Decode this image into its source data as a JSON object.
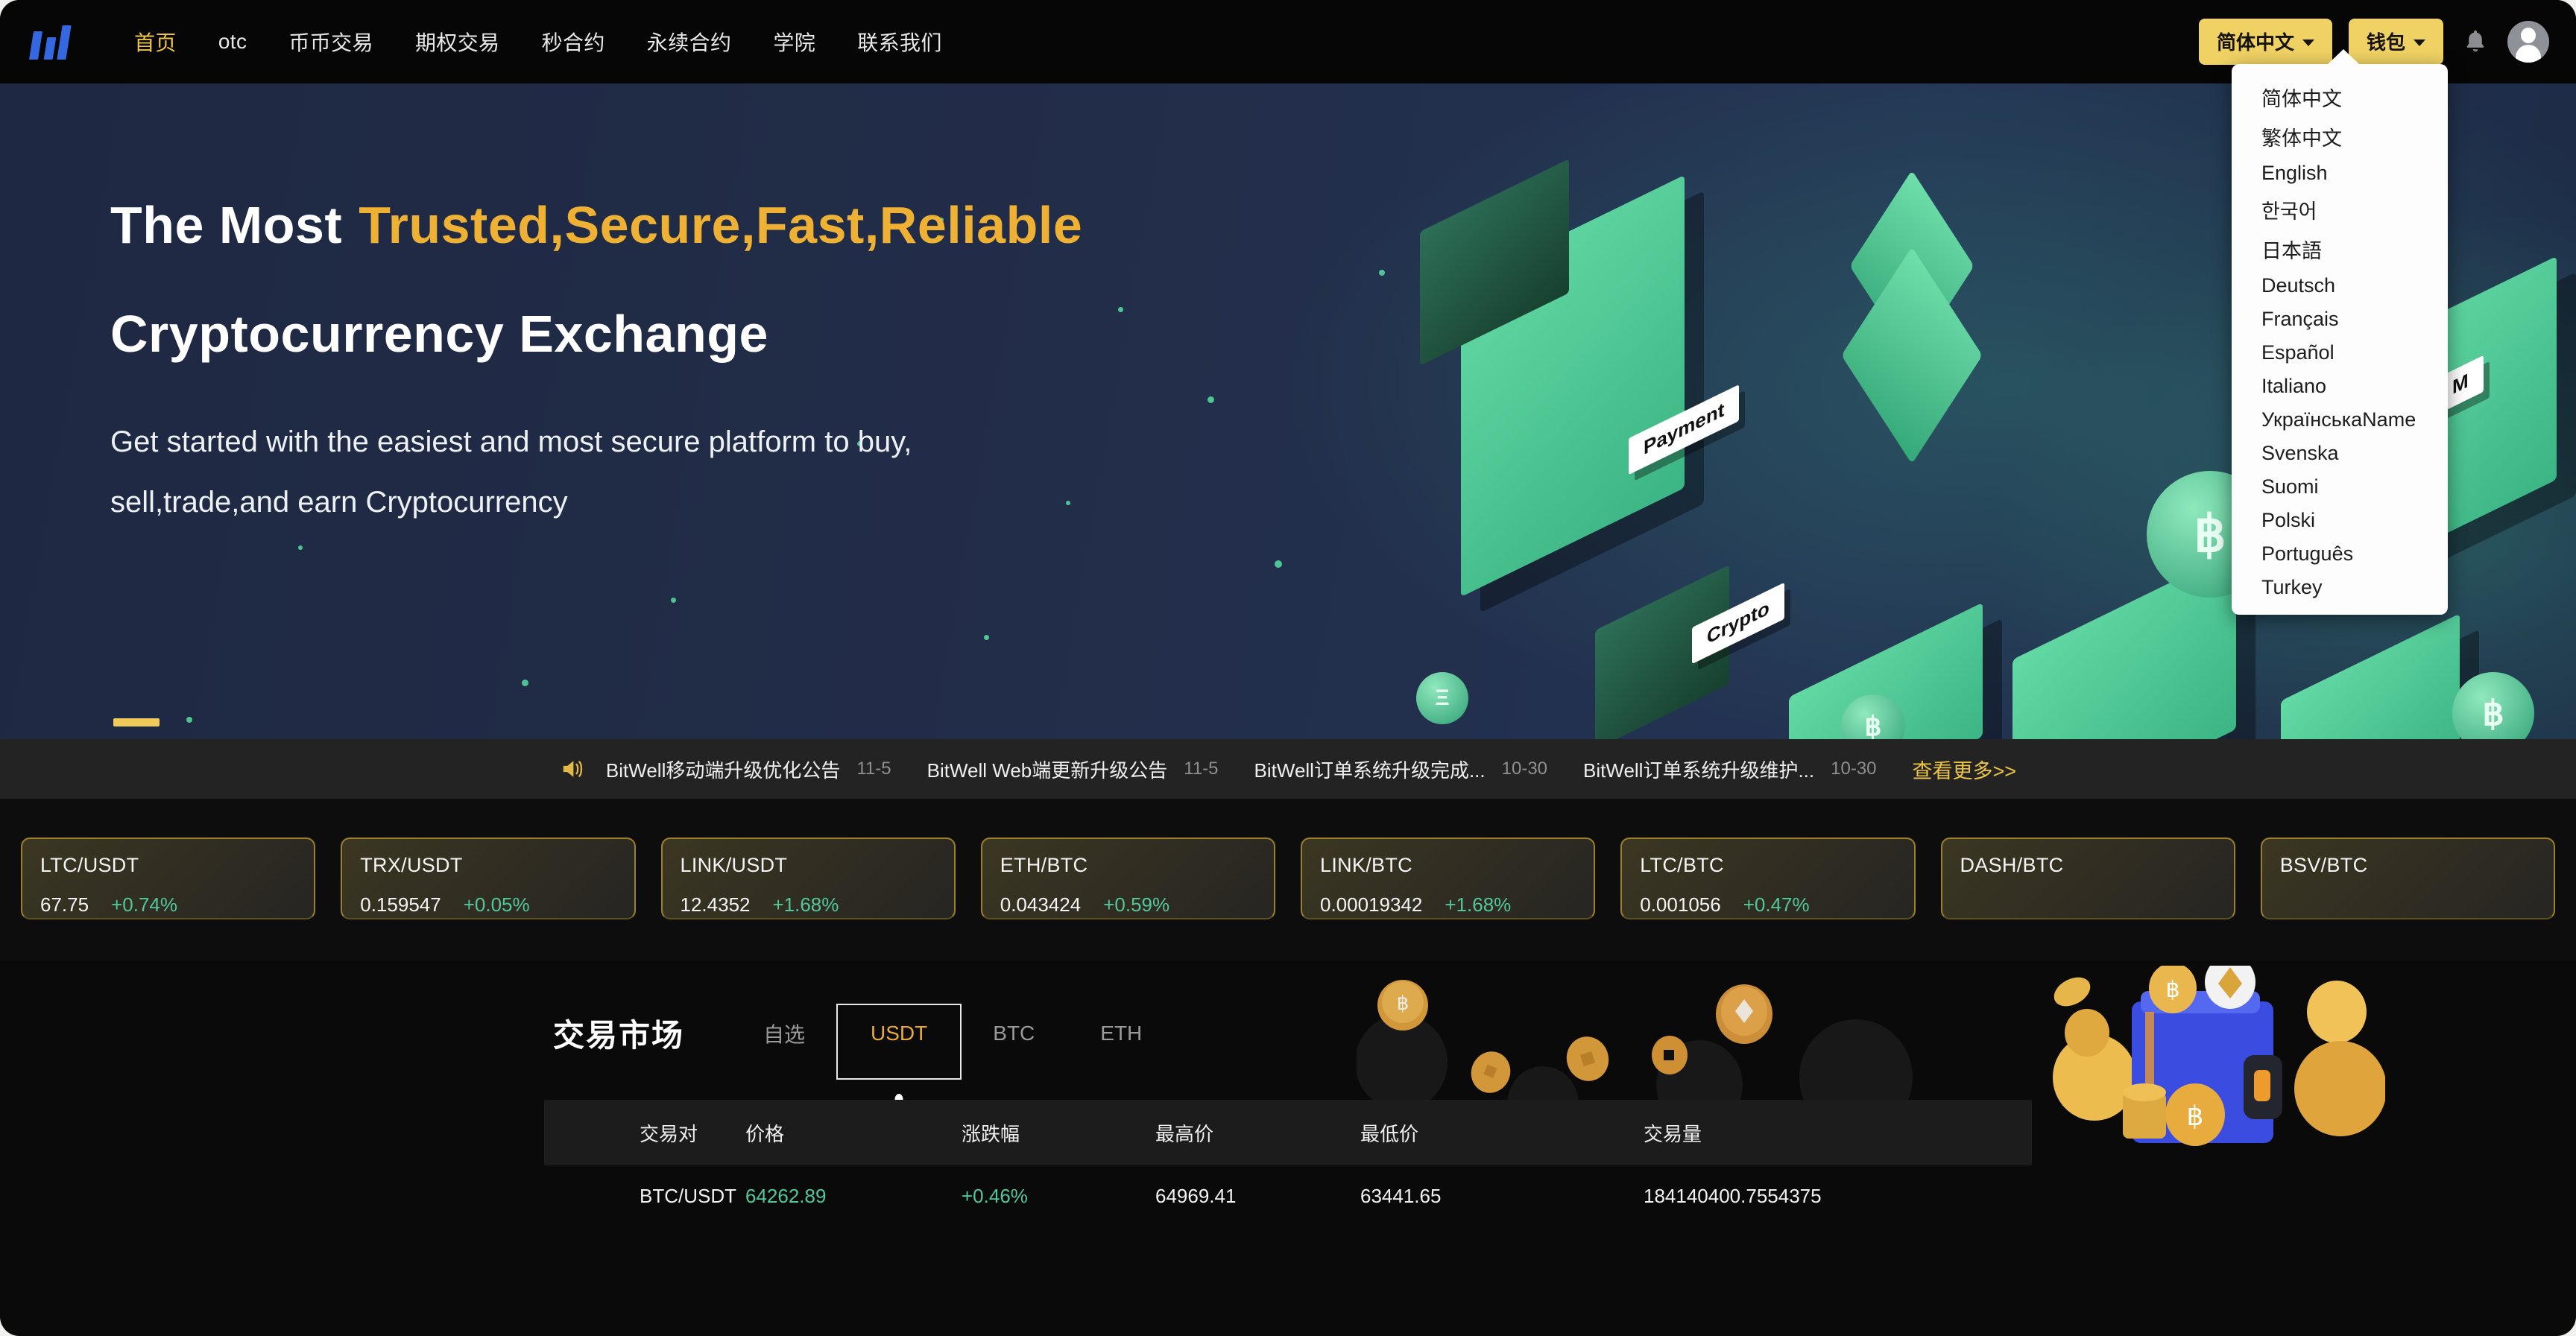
{
  "nav": {
    "logo_name": "bitwell-logo",
    "links": [
      {
        "label": "首页",
        "active": true
      },
      {
        "label": "otc",
        "active": false
      },
      {
        "label": "币币交易",
        "active": false
      },
      {
        "label": "期权交易",
        "active": false
      },
      {
        "label": "秒合约",
        "active": false
      },
      {
        "label": "永续合约",
        "active": false
      },
      {
        "label": "学院",
        "active": false
      },
      {
        "label": "联系我们",
        "active": false
      }
    ],
    "language_button": "简体中文",
    "wallet_button": "钱包",
    "accent_color": "#f0d264",
    "active_link_color": "#edc447"
  },
  "language_menu": {
    "open": true,
    "items": [
      "简体中文",
      "繁体中文",
      "English",
      "한국어",
      "日本語",
      "Deutsch",
      "Français",
      "Español",
      "Italiano",
      "УкраїнськаName",
      "Svenska",
      "Suomi",
      "Polski",
      "Português",
      "Turkey"
    ]
  },
  "hero": {
    "line1_white": "The Most",
    "line1_highlight": "Trusted,Secure,Fast,Reliable",
    "line2": "Cryptocurrency Exchange",
    "subtitle_line1": "Get started with the easiest and most secure platform to buy,",
    "subtitle_line2": "sell,trade,and earn Cryptocurrency",
    "highlight_color": "#eeb134",
    "background_color": "#222d47",
    "art_labels": [
      "Payment",
      "Crypto",
      "M"
    ]
  },
  "announcement": {
    "items": [
      {
        "title": "BitWell移动端升级优化公告",
        "date": "11-5"
      },
      {
        "title": "BitWell Web端更新升级公告",
        "date": "11-5"
      },
      {
        "title": "BitWell订单系统升级完成...",
        "date": "10-30"
      },
      {
        "title": "BitWell订单系统升级维护...",
        "date": "10-30"
      }
    ],
    "more_label": "查看更多>>",
    "more_color": "#edc447"
  },
  "tickers": [
    {
      "pair": "LTC/USDT",
      "price": "67.75",
      "change": "+0.74%"
    },
    {
      "pair": "TRX/USDT",
      "price": "0.159547",
      "change": "+0.05%"
    },
    {
      "pair": "LINK/USDT",
      "price": "12.4352",
      "change": "+1.68%"
    },
    {
      "pair": "ETH/BTC",
      "price": "0.043424",
      "change": "+0.59%"
    },
    {
      "pair": "LINK/BTC",
      "price": "0.00019342",
      "change": "+1.68%"
    },
    {
      "pair": "LTC/BTC",
      "price": "0.001056",
      "change": "+0.47%"
    },
    {
      "pair": "DASH/BTC",
      "price": "",
      "change": ""
    },
    {
      "pair": "BSV/BTC",
      "price": "",
      "change": ""
    }
  ],
  "market": {
    "title": "交易市场",
    "tabs": [
      {
        "label": "自选",
        "active": false,
        "focused": false
      },
      {
        "label": "USDT",
        "active": true,
        "focused": true
      },
      {
        "label": "BTC",
        "active": false,
        "focused": false
      },
      {
        "label": "ETH",
        "active": false,
        "focused": false
      }
    ],
    "columns": [
      "交易对",
      "价格",
      "涨跌幅",
      "最高价",
      "最低价",
      "交易量"
    ],
    "rows": [
      {
        "pair": "BTC/USDT",
        "price": "64262.89",
        "change": "+0.46%",
        "high": "64969.41",
        "low": "63441.65",
        "volume": "184140400.7554375"
      }
    ],
    "up_color": "#52c79a"
  }
}
